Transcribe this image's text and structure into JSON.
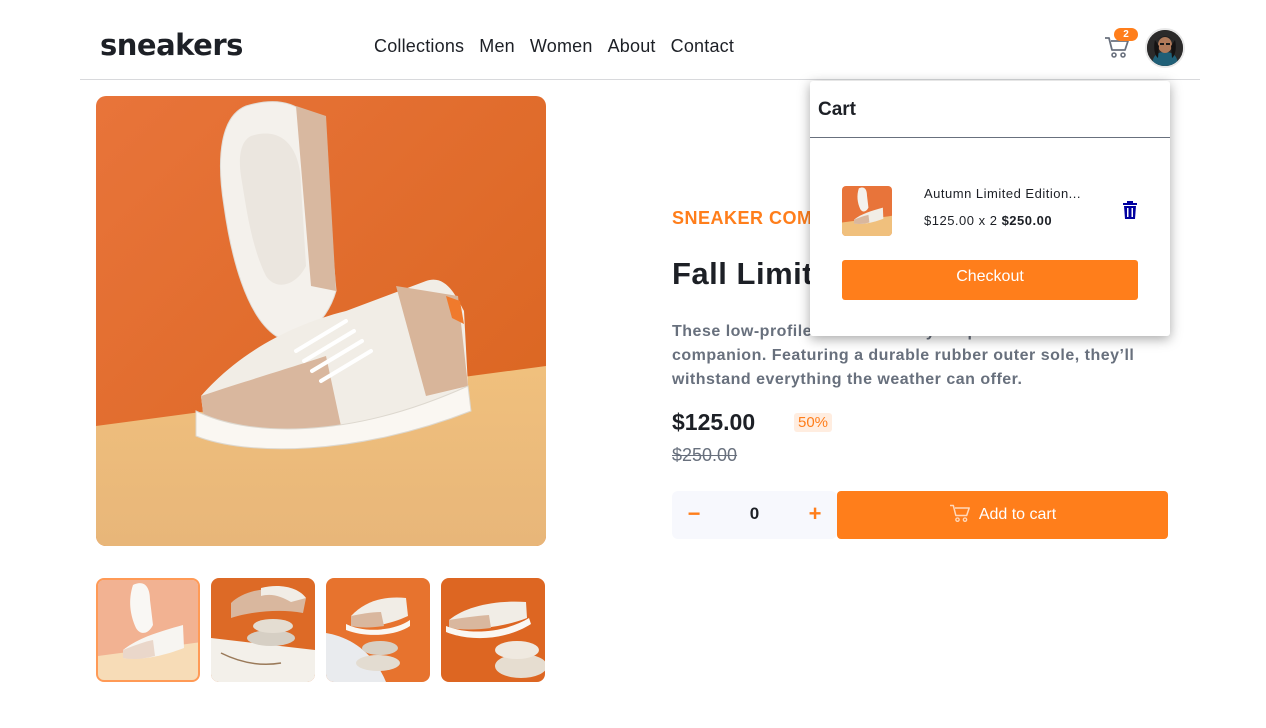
{
  "brand": {
    "logo": "sneakers"
  },
  "nav": {
    "items": [
      "Collections",
      "Men",
      "Women",
      "About",
      "Contact"
    ]
  },
  "header": {
    "cart_count": "2",
    "cart_icon": "cart-icon",
    "avatar": "user-avatar"
  },
  "product": {
    "company": "SNEAKER COMPANY",
    "title": "Fall Limited Edition Sneakers",
    "description": "These low-profile sneakers are your perfect casual wear companion. Featuring a durable rubber outer sole, they’ll withstand everything the weather can offer.",
    "price": "$125.00",
    "discount": "50%",
    "old_price": "$250.00",
    "quantity": "0",
    "minus_label": "−",
    "plus_label": "+",
    "add_to_cart": "Add to cart"
  },
  "cart": {
    "title": "Cart",
    "item_name": "Autumn Limited Edition...",
    "item_calc": "$125.00 x 2",
    "item_total": "$250.00",
    "checkout_label": "Checkout"
  },
  "colors": {
    "accent": "#ff7e1b",
    "accent_light": "#ffede0",
    "text_dark": "#1d2026",
    "text_gray": "#68707d",
    "trash_icon": "#0000a0"
  }
}
